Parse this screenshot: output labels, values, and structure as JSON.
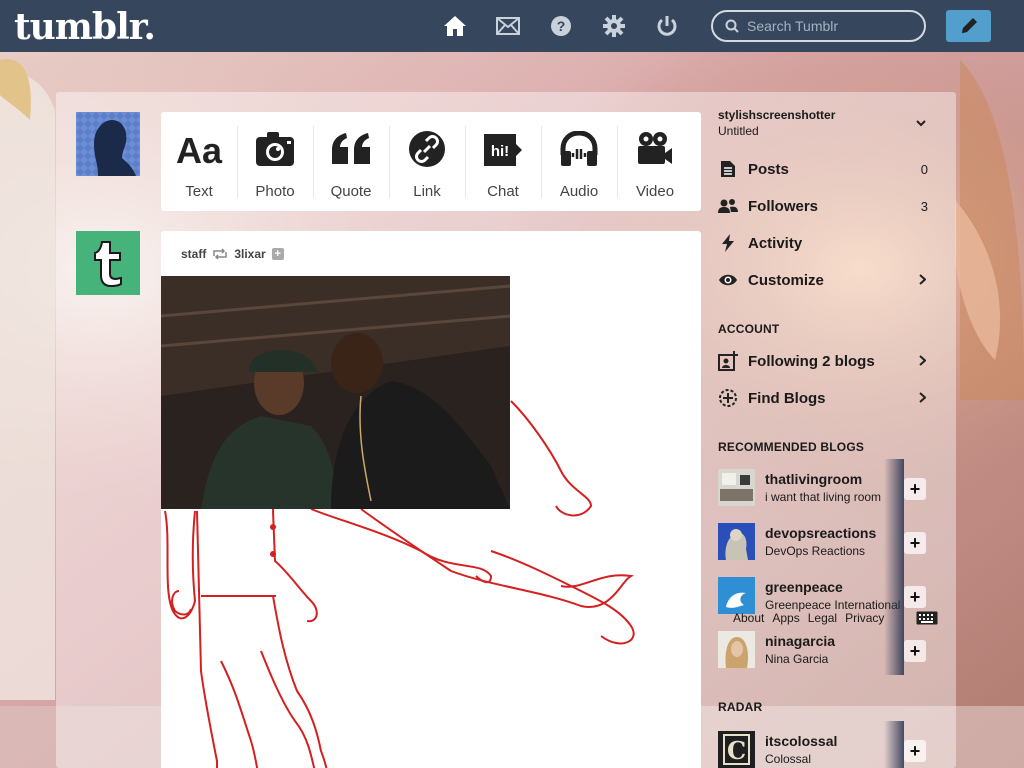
{
  "header": {
    "logo": "tumblr.",
    "nav_icons": [
      "home-icon",
      "mail-icon",
      "help-icon",
      "gear-icon",
      "power-icon"
    ],
    "search_placeholder": "Search Tumblr",
    "compose_icon": "pencil-icon"
  },
  "post_types": [
    {
      "label": "Text",
      "icon": "text-icon"
    },
    {
      "label": "Photo",
      "icon": "camera-icon"
    },
    {
      "label": "Quote",
      "icon": "quote-icon"
    },
    {
      "label": "Link",
      "icon": "link-icon"
    },
    {
      "label": "Chat",
      "icon": "chat-icon"
    },
    {
      "label": "Audio",
      "icon": "headphones-icon"
    },
    {
      "label": "Video",
      "icon": "video-camera-icon"
    }
  ],
  "post": {
    "author": "staff",
    "reblogged_from": "3lixar",
    "follow_badge": "+"
  },
  "sidebar": {
    "blog_name": "stylishscreenshotter",
    "blog_title": "Untitled",
    "rows": [
      {
        "label": "Posts",
        "count": "0",
        "icon": "posts-icon"
      },
      {
        "label": "Followers",
        "count": "3",
        "icon": "followers-icon"
      },
      {
        "label": "Activity",
        "count": "",
        "icon": "lightning-icon"
      },
      {
        "label": "Customize",
        "count": "",
        "icon": "eye-icon"
      }
    ],
    "account_title": "ACCOUNT",
    "account_rows": [
      {
        "label": "Following 2 blogs",
        "icon": "following-icon"
      },
      {
        "label": "Find Blogs",
        "icon": "find-blogs-icon"
      }
    ],
    "recommended_title": "RECOMMENDED BLOGS",
    "recommended": [
      {
        "name": "thatlivingroom",
        "desc": "i want that living room"
      },
      {
        "name": "devopsreactions",
        "desc": "DevOps Reactions"
      },
      {
        "name": "greenpeace",
        "desc": "Greenpeace International"
      },
      {
        "name": "ninagarcia",
        "desc": "Nina Garcia"
      }
    ],
    "footer_links": [
      "About",
      "Apps",
      "Legal",
      "Privacy"
    ],
    "radar_title": "RADAR",
    "radar": [
      {
        "name": "itscolossal",
        "desc": "Colossal"
      }
    ]
  },
  "colors": {
    "topbar": "#36465d",
    "compose": "#529ecc",
    "staff_avatar": "#46b37b"
  }
}
